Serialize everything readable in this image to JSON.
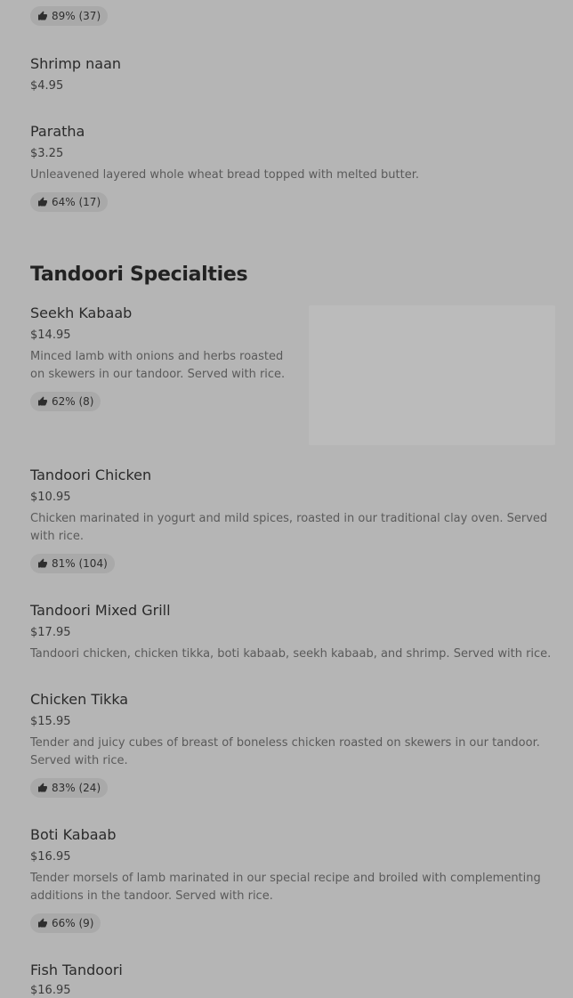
{
  "top_item": {
    "rating": "89% (37)"
  },
  "naan_section": {
    "items": [
      {
        "name": "Shrimp naan",
        "price": "$4.95"
      },
      {
        "name": "Paratha",
        "price": "$3.25",
        "description": "Unleavened layered whole wheat bread topped with melted butter.",
        "rating": "64% (17)"
      }
    ]
  },
  "tandoori_section": {
    "title": "Tandoori Specialties",
    "items": [
      {
        "name": "Seekh Kabaab",
        "price": "$14.95",
        "description": "Minced lamb with onions and herbs roasted on skewers in our tandoor. Served with rice.",
        "rating": "62% (8)"
      },
      {
        "name": "Tandoori Chicken",
        "price": "$10.95",
        "description": "Chicken marinated in yogurt and mild spices, roasted in our traditional clay oven. Served with rice.",
        "rating": "81% (104)"
      },
      {
        "name": "Tandoori Mixed Grill",
        "price": "$17.95",
        "description": "Tandoori chicken, chicken tikka, boti kabaab, seekh kabaab, and shrimp. Served with rice."
      },
      {
        "name": "Chicken Tikka",
        "price": "$15.95",
        "description": "Tender and juicy cubes of breast of boneless chicken roasted on skewers in our tandoor. Served with rice.",
        "rating": "83% (24)"
      },
      {
        "name": "Boti Kabaab",
        "price": "$16.95",
        "description": "Tender morsels of lamb marinated in our special recipe and broiled with complementing additions in the tandoor. Served with rice.",
        "rating": "66% (9)"
      },
      {
        "name": "Fish Tandoori",
        "price": "$16.95"
      }
    ]
  },
  "icons": {
    "rating": "thumbs-up-icon"
  },
  "colors": {
    "background": "#b5b5b5",
    "badge": "#a9a9a9"
  }
}
